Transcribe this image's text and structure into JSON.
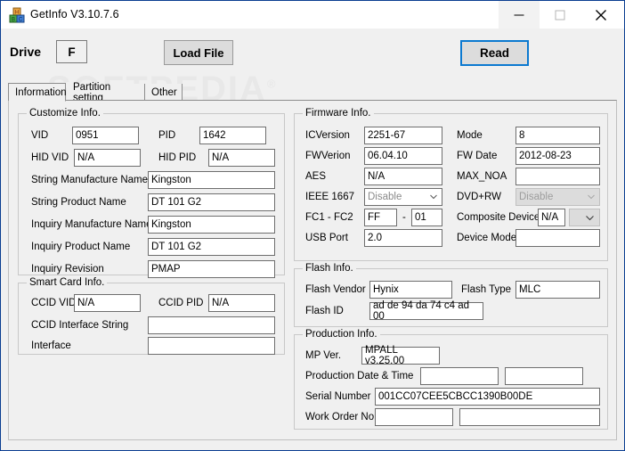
{
  "window": {
    "title": "GetInfo V3.10.7.6",
    "icon": "blocks-icon",
    "controls": {
      "minimize": "minimize-icon",
      "maximize": "maximize-icon",
      "close": "close-icon"
    },
    "accent_color": "#0b79d0",
    "border_color": "#0a3d91"
  },
  "watermark": {
    "text": "SOFTPEDIA",
    "mark": "®"
  },
  "toolbar": {
    "drive_label": "Drive",
    "drive_value": "F",
    "load_file_label": "Load File",
    "read_label": "Read"
  },
  "tabs": [
    {
      "label": "Information",
      "active": true
    },
    {
      "label": "Partition setting",
      "active": false
    },
    {
      "label": "Other",
      "active": false
    }
  ],
  "customize_info": {
    "title": "Customize Info.",
    "vid_label": "VID",
    "vid_value": "0951",
    "pid_label": "PID",
    "pid_value": "1642",
    "hid_vid_label": "HID VID",
    "hid_vid_value": "N/A",
    "hid_pid_label": "HID PID",
    "hid_pid_value": "N/A",
    "string_manufacture_label": "String Manufacture Name",
    "string_manufacture_value": "Kingston",
    "string_product_label": "String Product Name",
    "string_product_value": "DT 101 G2",
    "inquiry_manufacture_label": "Inquiry Manufacture Name",
    "inquiry_manufacture_value": "Kingston",
    "inquiry_product_label": "Inquiry Product Name",
    "inquiry_product_value": "DT 101 G2",
    "inquiry_revision_label": "Inquiry Revision",
    "inquiry_revision_value": "PMAP"
  },
  "smart_card_info": {
    "title": "Smart Card Info.",
    "ccid_vid_label": "CCID VID",
    "ccid_vid_value": "N/A",
    "ccid_pid_label": "CCID PID",
    "ccid_pid_value": "N/A",
    "ccid_interface_string_label": "CCID Interface String",
    "ccid_interface_string_value": "",
    "interface_label": "Interface",
    "interface_value": ""
  },
  "firmware_info": {
    "title": "Firmware Info.",
    "icversion_label": "ICVersion",
    "icversion_value": "2251-67",
    "mode_label": "Mode",
    "mode_value": "8",
    "fwversion_label": "FWVerion",
    "fwversion_value": "06.04.10",
    "fw_date_label": "FW Date",
    "fw_date_value": "2012-08-23",
    "aes_label": "AES",
    "aes_value": "N/A",
    "max_noa_label": "MAX_NOA",
    "max_noa_value": "",
    "ieee1667_label": "IEEE 1667",
    "ieee1667_value": "Disable",
    "dvdrw_label": "DVD+RW",
    "dvdrw_value": "Disable",
    "fc_label": "FC1 - FC2",
    "fc1_value": "FF",
    "fc_sep": "-",
    "fc2_value": "01",
    "composite_device_label": "Composite Device",
    "composite_device_value": "N/A",
    "usb_port_label": "USB Port",
    "usb_port_value": "2.0",
    "device_mode_label": "Device Mode",
    "device_mode_value": ""
  },
  "flash_info": {
    "title": "Flash Info.",
    "flash_vendor_label": "Flash Vendor",
    "flash_vendor_value": "Hynix",
    "flash_type_label": "Flash Type",
    "flash_type_value": "MLC",
    "flash_id_label": "Flash ID",
    "flash_id_value": "ad de 94 da 74 c4 ad 00"
  },
  "production_info": {
    "title": "Production Info.",
    "mp_ver_label": "MP Ver.",
    "mp_ver_value": "MPALL v3.25.00",
    "production_datetime_label": "Production Date & Time",
    "production_date_value": "",
    "production_time_value": "",
    "serial_number_label": "Serial Number",
    "serial_number_value": "001CC07CEE5CBCC1390B00DE",
    "work_order_label": "Work Order No.",
    "work_order_value_1": "",
    "work_order_value_2": ""
  }
}
